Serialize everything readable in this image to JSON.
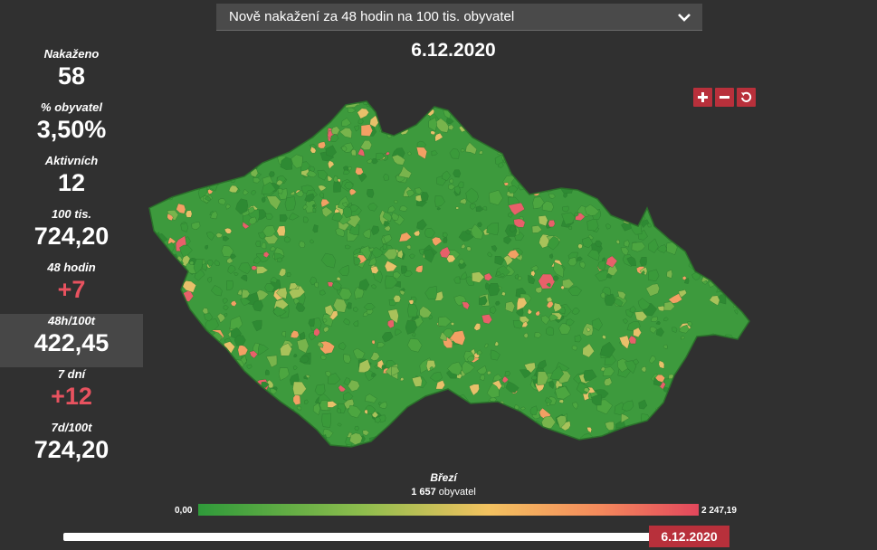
{
  "dropdown": {
    "selected": "Nově nakažení za 48 hodin na 100 tis. obyvatel"
  },
  "date": "6.12.2020",
  "stats": [
    {
      "label": "Nakaženo",
      "value": "58"
    },
    {
      "label": "% obyvatel",
      "value": "3,50%"
    },
    {
      "label": "Aktivních",
      "value": "12"
    },
    {
      "label": "100 tis.",
      "value": "724,20"
    },
    {
      "label": "48 hodin",
      "value": "+7"
    },
    {
      "label": "48h/100t",
      "value": "422,45"
    },
    {
      "label": "7 dní",
      "value": "+12"
    },
    {
      "label": "7d/100t",
      "value": "724,20"
    }
  ],
  "legend": {
    "place": "Březí",
    "population": "1 657",
    "population_unit": "obyvatel",
    "min": "0,00",
    "max": "2 247,19"
  },
  "timeline": {
    "date": "6.12.2020"
  },
  "colors": {
    "accent": "#b8303b",
    "negative": "#e8525f",
    "low": "#2f9a3a",
    "high": "#e2475c"
  },
  "icons": {
    "zoom_in": "plus-icon",
    "zoom_out": "minus-icon",
    "reset": "reset-icon",
    "dropdown": "chevron-down-icon"
  }
}
